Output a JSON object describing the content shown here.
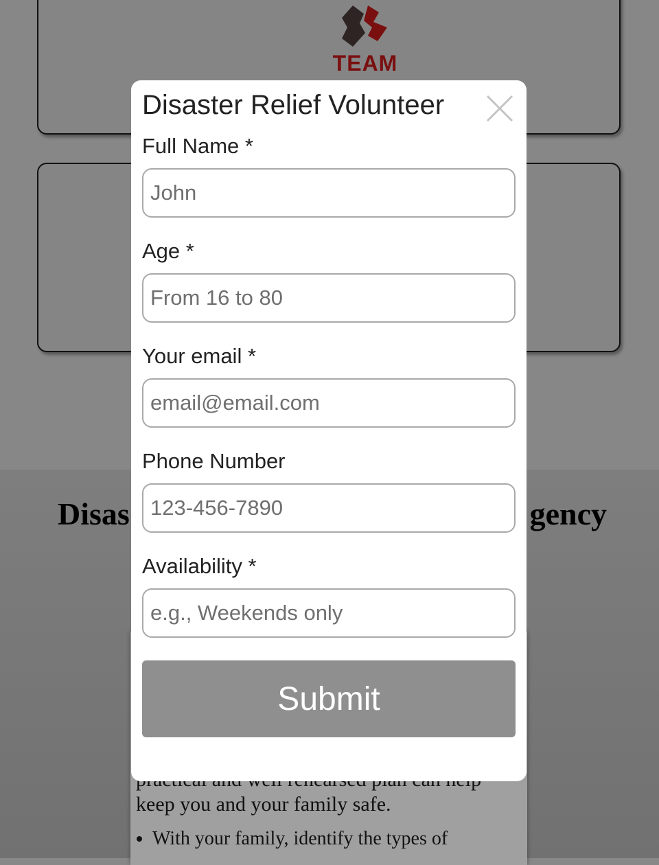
{
  "background": {
    "logo_text": "TEAM",
    "heading_left": "Disas",
    "heading_right": "gency",
    "body_text_line1": "practical and well rehearsed plan can help",
    "body_text_line2": "keep you and your family safe.",
    "bullet_1": "With your family, identify the types of"
  },
  "modal": {
    "title": "Disaster Relief Volunteer",
    "fields": [
      {
        "label": "Full Name *",
        "placeholder": "John"
      },
      {
        "label": "Age *",
        "placeholder": "From 16 to 80"
      },
      {
        "label": "Your email *",
        "placeholder": "email@email.com"
      },
      {
        "label": "Phone Number",
        "placeholder": "123-456-7890"
      },
      {
        "label": "Availability *",
        "placeholder": "e.g., Weekends only"
      }
    ],
    "submit_label": "Submit",
    "close_icon": "close-icon"
  },
  "colors": {
    "overlay": "#888888",
    "modal_bg": "#ffffff",
    "submit_bg": "#8f8f8f",
    "logo_red": "#7a0f0f"
  }
}
